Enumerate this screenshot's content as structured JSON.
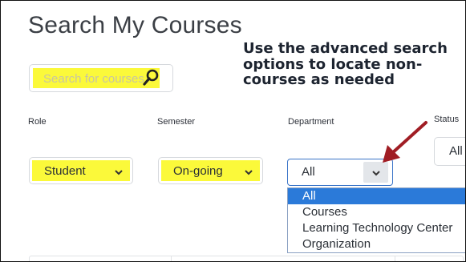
{
  "page": {
    "title": "Search My Courses"
  },
  "callout": {
    "text": "Use the advanced search options to locate non-courses as needed"
  },
  "search": {
    "placeholder": "Search for courses"
  },
  "filters": {
    "role": {
      "label": "Role",
      "value": "Student"
    },
    "semester": {
      "label": "Semester",
      "value": "On-going"
    },
    "department": {
      "label": "Department",
      "value": "All",
      "options": [
        "All",
        "Courses",
        "Learning Technology Center",
        "Organization"
      ],
      "selected_index": 0
    },
    "status": {
      "label": "Status",
      "value": "All"
    }
  },
  "colors": {
    "highlight": "#fbf93a",
    "accent": "#2b7ad9",
    "arrow": "#a01d24"
  },
  "icons": {
    "search": "magnifier-icon",
    "chevron": "chevron-down-icon"
  }
}
